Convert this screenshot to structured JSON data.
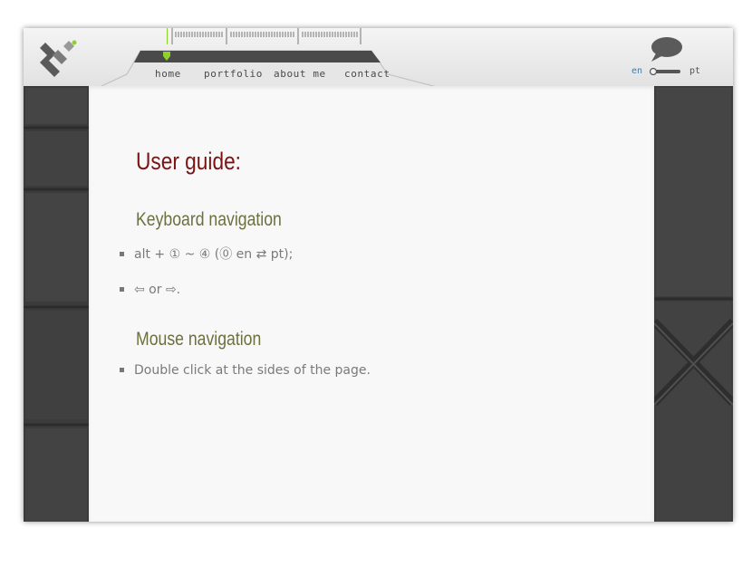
{
  "nav": {
    "items": [
      "home",
      "portfolio",
      "about me",
      "contact"
    ]
  },
  "lang": {
    "left": "en",
    "right": "pt",
    "active": "en"
  },
  "content": {
    "title": "User guide:",
    "sections": [
      {
        "heading": "Keyboard navigation",
        "items": [
          "alt + ① ~ ④ (⓪ en ⇄ pt);",
          "⇦ or ⇨."
        ]
      },
      {
        "heading": "Mouse navigation",
        "items": [
          "Double click at the sides of the page."
        ]
      }
    ]
  },
  "colors": {
    "title": "#7a1414",
    "heading": "#6c7040",
    "body_text": "#7a7a7a",
    "active_indicator": "#8fd12b",
    "active_lang": "#3d7fb0"
  },
  "icons": [
    "logo-icon",
    "speech-bubble-icon",
    "active-nav-indicator-icon",
    "language-toggle-icon"
  ]
}
